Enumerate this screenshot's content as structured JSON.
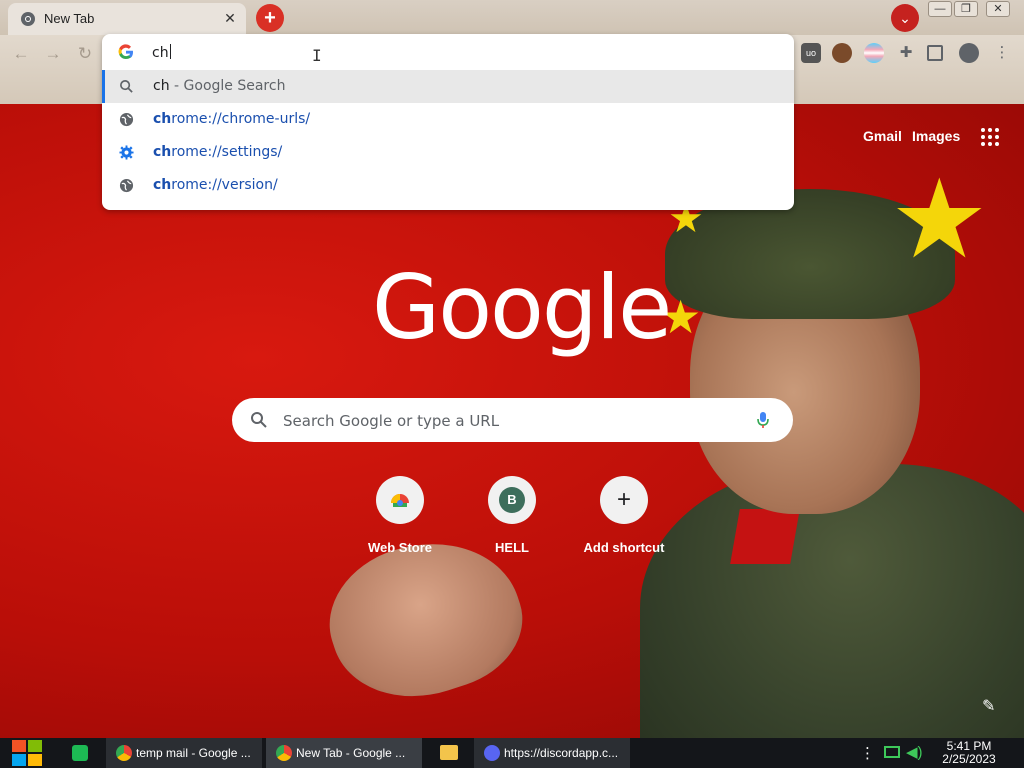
{
  "browser": {
    "tab_title": "New Tab",
    "tab_close": "✕",
    "new_tab": "+",
    "tab_search": "⌄",
    "window_controls": {
      "minimize": "—",
      "restore": "❐",
      "close": "✕"
    }
  },
  "omnibox": {
    "input_value": "ch",
    "suggestions": [
      {
        "icon": "search-icon",
        "match": "ch",
        "rest": " - Google Search",
        "type": "search"
      },
      {
        "icon": "globe-icon",
        "match": "ch",
        "rest": "rome://chrome-urls/",
        "type": "url"
      },
      {
        "icon": "gear-icon",
        "match": "ch",
        "rest": "rome://settings/",
        "type": "url"
      },
      {
        "icon": "globe-icon",
        "match": "ch",
        "rest": "rome://version/",
        "type": "url"
      }
    ]
  },
  "ntp": {
    "gmail_link": "Gmail",
    "images_link": "Images",
    "logo_text": "Google",
    "search_placeholder": "Search Google or type a URL",
    "shortcuts": [
      {
        "label": "Web Store",
        "glyph": ""
      },
      {
        "label": "HELL",
        "glyph": "B"
      },
      {
        "label": "Add shortcut",
        "glyph": "+"
      }
    ]
  },
  "taskbar": {
    "apps": [
      {
        "label": "temp mail - Google ...",
        "icon": "chrome-icon"
      },
      {
        "label": "New Tab - Google ...",
        "icon": "chrome-icon"
      },
      {
        "label": "https://discordapp.c...",
        "icon": "discord-icon"
      }
    ],
    "time": "5:41 PM",
    "date": "2/25/2023"
  },
  "colors": {
    "accent": "#1a73e8",
    "background_red": "#c4150c",
    "newtab_red": "#d93025",
    "link_blue": "#1a4fae"
  }
}
